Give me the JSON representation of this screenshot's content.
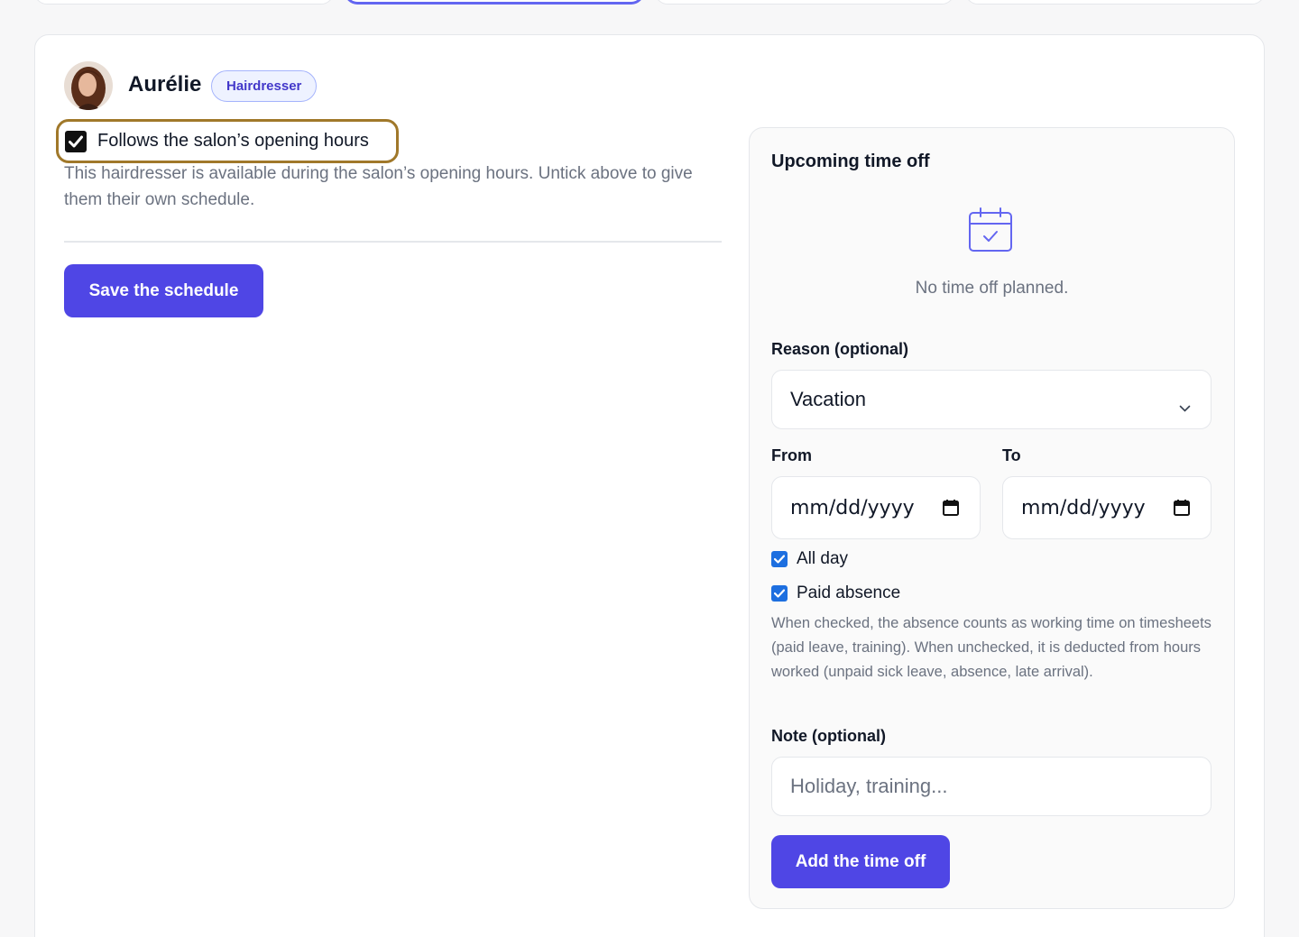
{
  "staff": {
    "name": "Aurélie",
    "role": "Hairdresser"
  },
  "schedule": {
    "follow_label": "Follows the salon’s opening hours",
    "follow_checked": true,
    "follow_help": "This hairdresser is available during the salon’s opening hours. Untick above to give them their own schedule.",
    "save_label": "Save the schedule"
  },
  "time_off": {
    "title": "Upcoming time off",
    "empty_text": "No time off planned.",
    "reason_label": "Reason (optional)",
    "reason_value": "Vacation",
    "from_label": "From",
    "to_label": "To",
    "from_placeholder": "mm/dd/yyyy",
    "to_placeholder": "mm/dd/yyyy",
    "all_day_label": "All day",
    "all_day_checked": true,
    "paid_label": "Paid absence",
    "paid_checked": true,
    "paid_help": "When checked, the absence counts as working time on timesheets (paid leave, training). When unchecked, it is deducted from hours worked (unpaid sick leave, absence, late arrival).",
    "note_label": "Note (optional)",
    "note_placeholder": "Holiday, training...",
    "add_label": "Add the time off"
  },
  "colors": {
    "accent": "#4f46e5",
    "highlight_border": "#a0782a",
    "checkbox_blue": "#1d6fe0"
  },
  "icons": {
    "calendar": "calendar-check-icon",
    "chevron": "chevron-down-icon"
  }
}
